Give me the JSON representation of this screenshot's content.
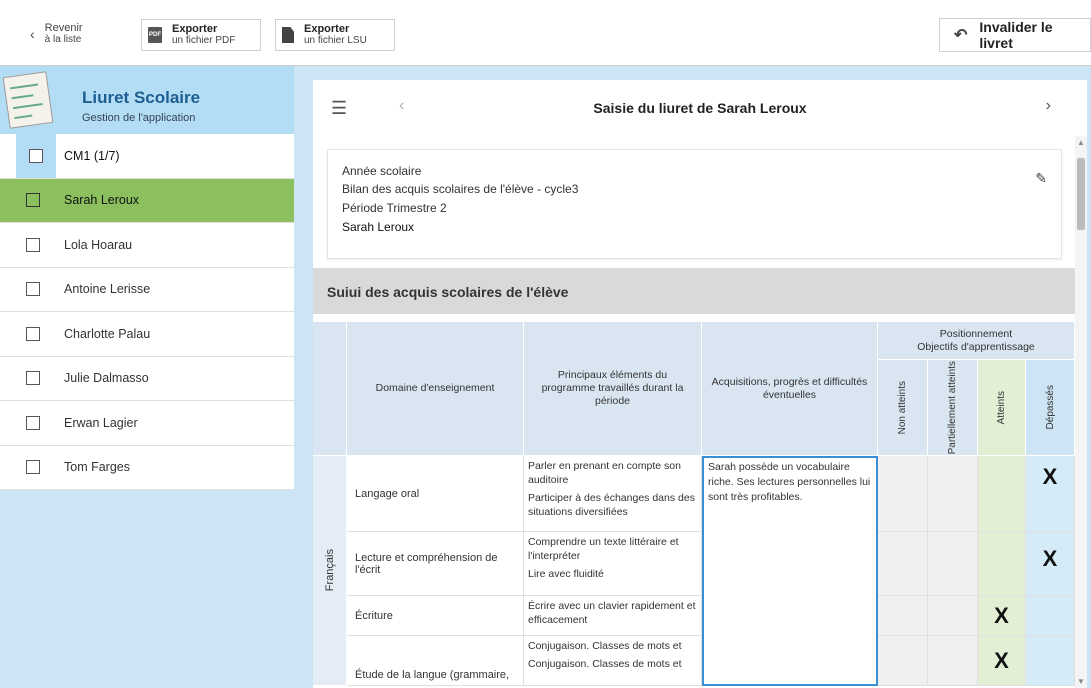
{
  "toolbar": {
    "back": {
      "line1": "Revenir",
      "line2": "à la liste",
      "icon": "chevron-left-icon"
    },
    "export_pdf": {
      "line1": "Exporter",
      "line2": "un fichier PDF",
      "icon_text": "PDF"
    },
    "export_lsu": {
      "line1": "Exporter",
      "line2": "un fichier LSU"
    },
    "invalidate": {
      "label": "Invalider le livret"
    }
  },
  "app": {
    "title": "Liuret Scolaire",
    "subtitle": "Gestion de l'application"
  },
  "students": [
    {
      "name": "CM1 (1/7)",
      "kind": "group"
    },
    {
      "name": "Sarah Leroux",
      "kind": "active"
    },
    {
      "name": "Lola Hoarau"
    },
    {
      "name": "Antoine Lerisse"
    },
    {
      "name": "Charlotte Palau"
    },
    {
      "name": "Julie Dalmasso"
    },
    {
      "name": "Erwan Lagier"
    },
    {
      "name": "Tom Farges"
    }
  ],
  "header": {
    "title": "Saisie du liuret de Sarah Leroux"
  },
  "info": {
    "line1": "Année scolaire",
    "line2": "Bilan des acquis scolaires de l'élève - cycle3",
    "line3": "Période Trimestre 2",
    "name": "Sarah Leroux"
  },
  "section": {
    "title": "Suiui des acquis scolaires de l'élève"
  },
  "table": {
    "headers": {
      "domain": "Domaine d'enseignement",
      "elements": "Principaux éléments du programme travaillés durant la période",
      "acq": "Acquisitions, progrès et difficultés éventuelles",
      "pos_line1": "Positionnement",
      "pos_line2": "Objectifs d'apprentissage",
      "non": "Non atteints",
      "partiel": "Partiellement atteints",
      "atteints": "Atteints",
      "depasses": "Dépassés"
    },
    "subject": "Français",
    "acquisitions": "Sarah possède un vocabulaire riche. Ses lectures personnelles lui sont très profitables.",
    "rows": [
      {
        "domain": "Langage oral",
        "elements": [
          "Parler en prenant en compte son auditoire",
          "Participer à des échanges dans des situations diversifiées"
        ],
        "mark": "X"
      },
      {
        "domain": "Lecture et compréhension de l'écrit",
        "elements": [
          "Comprendre un texte littéraire et l'interpréter",
          "Lire avec fluidité"
        ],
        "mark": "X"
      },
      {
        "domain": "Écriture",
        "elements": [
          "Écrire avec un clavier rapidement et efficacement"
        ],
        "mark": "X"
      },
      {
        "domain": "Étude de la langue (grammaire,",
        "elements": [
          "Conjugaison. Classes de mots et",
          "Conjugaison. Classes de mots et"
        ],
        "mark": "X"
      }
    ]
  }
}
